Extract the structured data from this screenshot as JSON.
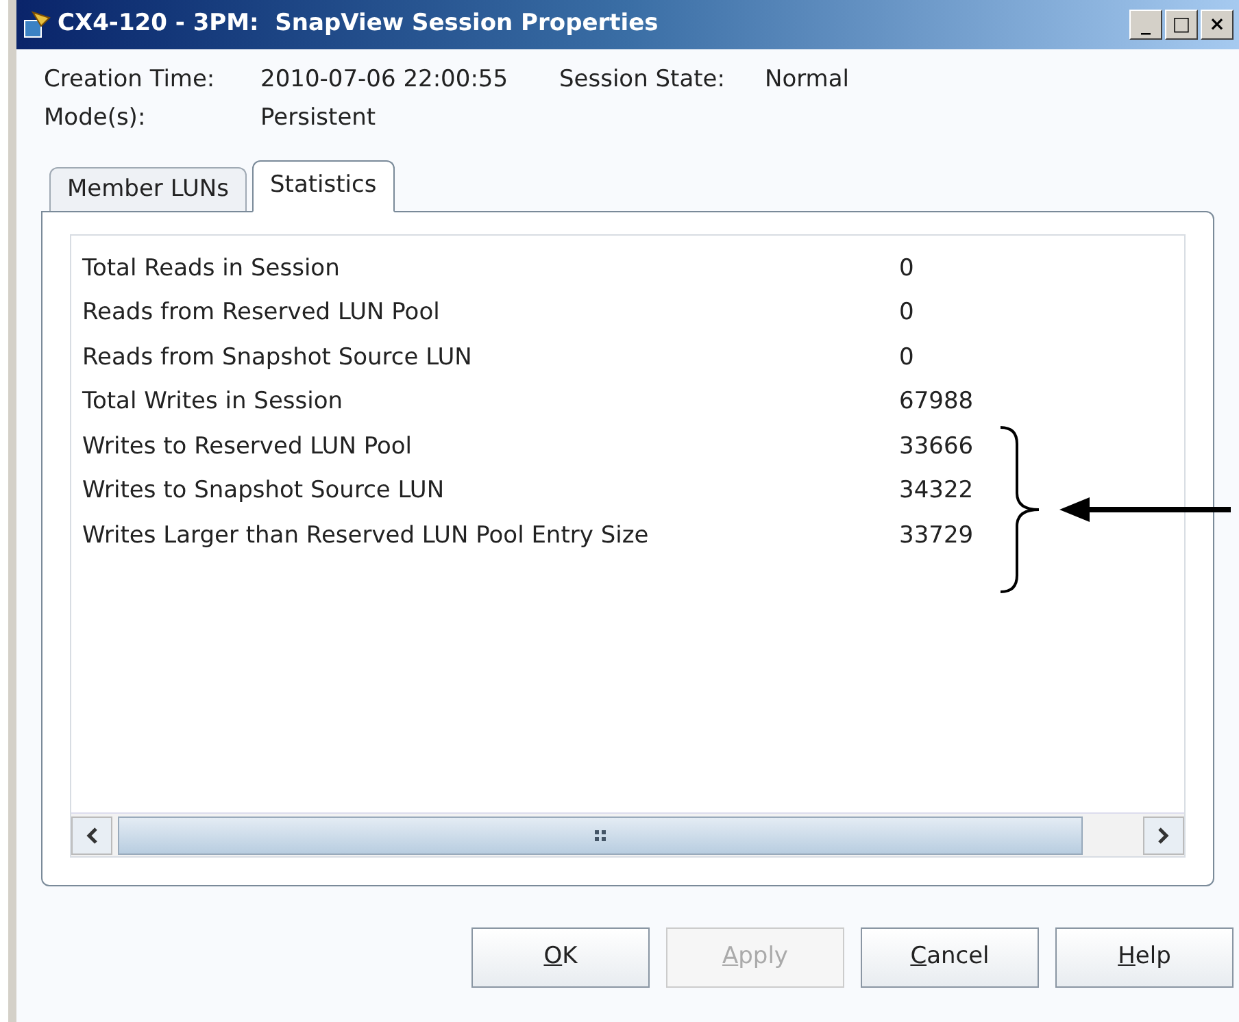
{
  "window": {
    "title": "CX4-120 - 3PM:  SnapView Session Properties",
    "controls": [
      "_",
      "□",
      "×"
    ]
  },
  "info": [
    {
      "label": "Creation Time:",
      "value": "2010-07-06 22:00:55"
    },
    {
      "label": "Session State:",
      "value": "Normal"
    },
    {
      "label": "Mode(s):",
      "value": "Persistent"
    }
  ],
  "tabs": [
    {
      "label": "Member LUNs",
      "selected": false
    },
    {
      "label": "Statistics",
      "selected": true
    }
  ],
  "statistics": [
    {
      "name": "Total Reads in Session",
      "value": "0"
    },
    {
      "name": "Reads from Reserved LUN Pool",
      "value": "0"
    },
    {
      "name": "Reads from Snapshot Source LUN",
      "value": "0"
    },
    {
      "name": "Total Writes in Session",
      "value": "67988"
    },
    {
      "name": "Writes to Reserved LUN Pool",
      "value": "33666"
    },
    {
      "name": "Writes to Snapshot Source LUN",
      "value": "34322"
    },
    {
      "name": "Writes Larger than Reserved LUN Pool Entry Size",
      "value": "33729"
    }
  ],
  "buttons": [
    {
      "label": "OK",
      "disabled": false
    },
    {
      "label": "Apply",
      "disabled": true
    },
    {
      "label": "Cancel",
      "disabled": false
    },
    {
      "label": "Help",
      "disabled": false
    }
  ]
}
